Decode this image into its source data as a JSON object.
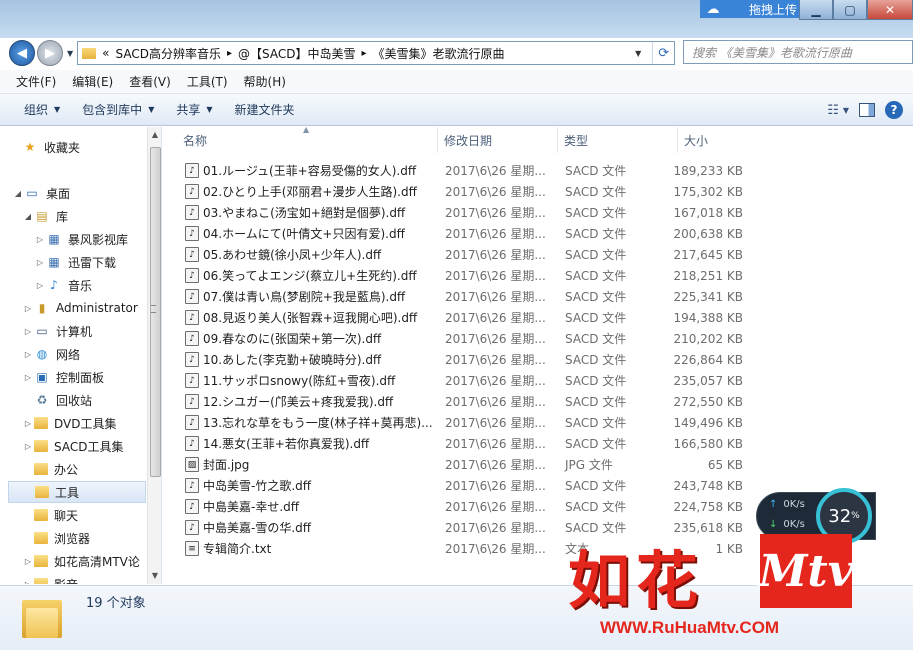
{
  "titlebar": {
    "minimize": "▁",
    "maximize": "▢",
    "close": "✕"
  },
  "baidu": {
    "label": "拖拽上传"
  },
  "address": {
    "root": "«",
    "crumbs": [
      "SACD高分辨率音乐",
      "@【SACD】中岛美雪",
      "《美雪集》老歌流行原曲"
    ],
    "sep": "▸",
    "refresh": "⟳"
  },
  "search": {
    "placeholder": "搜索 《美雪集》老歌流行原曲"
  },
  "menu": [
    "文件(F)",
    "编辑(E)",
    "查看(V)",
    "工具(T)",
    "帮助(H)"
  ],
  "toolbar": {
    "organize": "组织",
    "include": "包含到库中",
    "share": "共享",
    "newfolder": "新建文件夹",
    "help": "?"
  },
  "nav": [
    {
      "label": "收藏夹",
      "icon": "★"
    },
    {
      "label": "桌面",
      "icon": "▭"
    },
    {
      "label": "库",
      "icon": "▤"
    },
    {
      "label": "暴风影视库",
      "icon": "▦"
    },
    {
      "label": "迅雷下载",
      "icon": "▦"
    },
    {
      "label": "音乐",
      "icon": "♪"
    },
    {
      "label": "Administrator",
      "icon": "▮"
    },
    {
      "label": "计算机",
      "icon": "▭"
    },
    {
      "label": "网络",
      "icon": "◍"
    },
    {
      "label": "控制面板",
      "icon": "▣"
    },
    {
      "label": "回收站",
      "icon": "♻"
    },
    {
      "label": "DVD工具集",
      "icon": ""
    },
    {
      "label": "SACD工具集",
      "icon": ""
    },
    {
      "label": "办公",
      "icon": ""
    },
    {
      "label": "工具",
      "icon": ""
    },
    {
      "label": "聊天",
      "icon": ""
    },
    {
      "label": "浏览器",
      "icon": ""
    },
    {
      "label": "如花高清MTV论",
      "icon": ""
    },
    {
      "label": "影音",
      "icon": ""
    }
  ],
  "columns": {
    "name": "名称",
    "date": "修改日期",
    "type": "类型",
    "size": "大小"
  },
  "files": [
    {
      "name": "01.ルージュ(王菲+容易受傷的女人).dff",
      "date": "2017\\6\\26 星期...",
      "type": "SACD 文件",
      "size": "189,233 KB",
      "icon": "♪"
    },
    {
      "name": "02.ひとり上手(邓丽君+漫步人生路).dff",
      "date": "2017\\6\\26 星期...",
      "type": "SACD 文件",
      "size": "175,302 KB",
      "icon": "♪"
    },
    {
      "name": "03.やまねこ(汤宝如+絕對是個夢).dff",
      "date": "2017\\6\\26 星期...",
      "type": "SACD 文件",
      "size": "167,018 KB",
      "icon": "♪"
    },
    {
      "name": "04.ホームにて(叶倩文+只因有爱).dff",
      "date": "2017\\6\\26 星期...",
      "type": "SACD 文件",
      "size": "200,638 KB",
      "icon": "♪"
    },
    {
      "name": "05.あわせ鏡(徐小凤+少年人).dff",
      "date": "2017\\6\\26 星期...",
      "type": "SACD 文件",
      "size": "217,645 KB",
      "icon": "♪"
    },
    {
      "name": "06.笑ってよエンジ(蔡立儿+生死约).dff",
      "date": "2017\\6\\26 星期...",
      "type": "SACD 文件",
      "size": "218,251 KB",
      "icon": "♪"
    },
    {
      "name": "07.僕は青い鳥(梦剧院+我是藍鳥).dff",
      "date": "2017\\6\\26 星期...",
      "type": "SACD 文件",
      "size": "225,341 KB",
      "icon": "♪"
    },
    {
      "name": "08.見返り美人(张智霖+逗我開心吧).dff",
      "date": "2017\\6\\26 星期...",
      "type": "SACD 文件",
      "size": "194,388 KB",
      "icon": "♪"
    },
    {
      "name": "09.春なのに(张国荣+第一次).dff",
      "date": "2017\\6\\26 星期...",
      "type": "SACD 文件",
      "size": "210,202 KB",
      "icon": "♪"
    },
    {
      "name": "10.あした(李克勤+破曉時分).dff",
      "date": "2017\\6\\26 星期...",
      "type": "SACD 文件",
      "size": "226,864 KB",
      "icon": "♪"
    },
    {
      "name": "11.サッポロsnowy(陈紅+雪夜).dff",
      "date": "2017\\6\\26 星期...",
      "type": "SACD 文件",
      "size": "235,057 KB",
      "icon": "♪"
    },
    {
      "name": "12.シユガー(邝美云+疼我爱我).dff",
      "date": "2017\\6\\26 星期...",
      "type": "SACD 文件",
      "size": "272,550 KB",
      "icon": "♪"
    },
    {
      "name": "13.忘れな草をもう一度(林子祥+莫再悲)....",
      "date": "2017\\6\\26 星期...",
      "type": "SACD 文件",
      "size": "149,496 KB",
      "icon": "♪"
    },
    {
      "name": "14.悪女(王菲+若你真爱我).dff",
      "date": "2017\\6\\26 星期...",
      "type": "SACD 文件",
      "size": "166,580 KB",
      "icon": "♪"
    },
    {
      "name": "封面.jpg",
      "date": "2017\\6\\26 星期...",
      "type": "JPG 文件",
      "size": "65 KB",
      "icon": "▨"
    },
    {
      "name": "中岛美雪-竹之歌.dff",
      "date": "2017\\6\\26 星期...",
      "type": "SACD 文件",
      "size": "243,748 KB",
      "icon": "♪"
    },
    {
      "name": "中島美嘉-幸せ.dff",
      "date": "2017\\6\\26 星期...",
      "type": "SACD 文件",
      "size": "224,758 KB",
      "icon": "♪"
    },
    {
      "name": "中島美嘉-雪の华.dff",
      "date": "2017\\6\\26 星期...",
      "type": "SACD 文件",
      "size": "235,618 KB",
      "icon": "♪"
    },
    {
      "name": "专辑简介.txt",
      "date": "2017\\6\\26 星期...",
      "type": "文本",
      "size": "1 KB",
      "icon": "≡"
    }
  ],
  "status": {
    "count": "19 个对象"
  },
  "netmon": {
    "up": "0K/s",
    "down": "0K/s",
    "percent": "32",
    "pct_sign": "%",
    "up_arrow": "↑",
    "down_arrow": "↓"
  },
  "watermark": {
    "chars": "如花",
    "mtv": "Mtv",
    "url": "WWW.RuHuaMtv.COM"
  }
}
